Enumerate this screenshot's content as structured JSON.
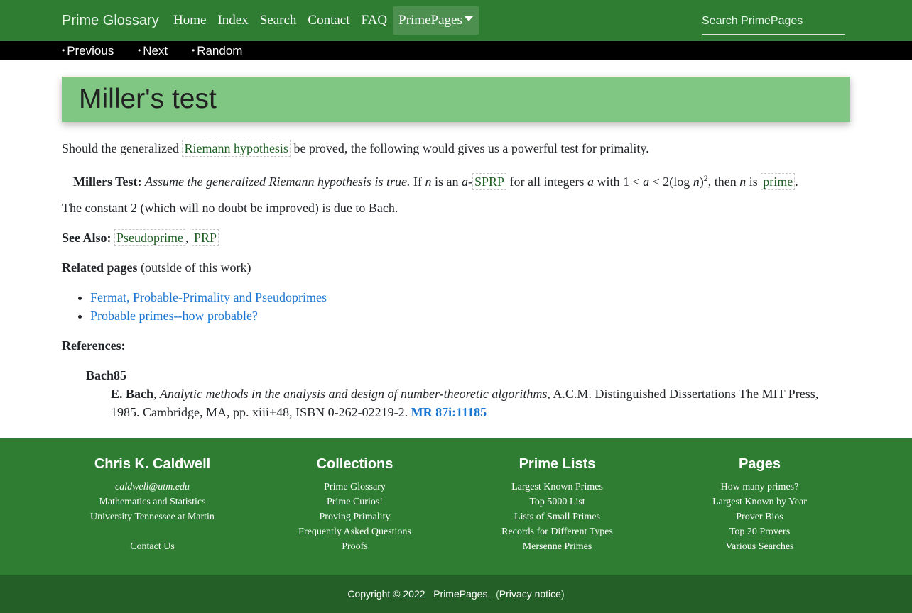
{
  "navbar": {
    "brand": "Prime Glossary",
    "links": [
      "Home",
      "Index",
      "Search",
      "Contact",
      "FAQ"
    ],
    "dropdown_label": "PrimePages",
    "search_placeholder": "Search PrimePages"
  },
  "subnav": {
    "previous": "Previous",
    "next": "Next",
    "random": "Random"
  },
  "page_title": "Miller's test",
  "intro": {
    "before": "Should the generalized ",
    "link": "Riemann hypothesis",
    "after": " be proved, the following would gives us a powerful test for primality."
  },
  "test": {
    "label": "Millers Test:",
    "assume": "Assume the generalized Riemann hypothesis is true.",
    "t1": " If ",
    "n1": "n",
    "t2": " is an ",
    "a1": "a",
    "dash": "-",
    "sprp": "SPRP",
    "t3": " for all integers ",
    "a2": "a",
    "t4": " with 1 < ",
    "a3": "a",
    "t5": " < 2(log ",
    "n2": "n",
    "t6": ")",
    "exp": "2",
    "t7": ", then ",
    "n3": "n",
    "t8": " is ",
    "prime": "prime",
    "t9": "."
  },
  "constant_note": "The constant 2 (which will no doubt be improved) is due to Bach.",
  "see_also": {
    "label": "See Also:",
    "links": [
      "Pseudoprime",
      "PRP"
    ],
    "separator": ", "
  },
  "related": {
    "label": "Related pages",
    "suffix": " (outside of this work)",
    "links": [
      "Fermat, Probable-Primality and Pseudoprimes",
      "Probable primes--how probable?"
    ]
  },
  "references": {
    "label": "References:",
    "key": "Bach85",
    "author": "E. Bach",
    "comma": ", ",
    "title": "Analytic methods in the analysis and design of number-theoretic algorithms",
    "rest": ", A.C.M. Distinguished Dissertations The MIT Press, 1985.  Cambridge, MA, pp. xiii+48, ISBN 0-262-02219-2. ",
    "mr": "MR 87i:11185"
  },
  "footer": {
    "columns": [
      {
        "title": "Chris K. Caldwell",
        "items": [
          "caldwell@utm.edu",
          "Mathematics and Statistics",
          "University Tennessee at Martin",
          "",
          "Contact Us"
        ]
      },
      {
        "title": "Collections",
        "items": [
          "Prime Glossary",
          "Prime Curios!",
          "Proving Primality",
          "Frequently Asked Questions",
          "Proofs"
        ]
      },
      {
        "title": "Prime Lists",
        "items": [
          "Largest Known Primes",
          "Top 5000 List",
          "Lists of Small Primes",
          "Records for Different Types",
          "Mersenne Primes"
        ]
      },
      {
        "title": "Pages",
        "items": [
          "How many primes?",
          "Largest Known by Year",
          "Prover Bios",
          "Top 20 Provers",
          "Various Searches"
        ]
      }
    ],
    "copyright": "Copyright © 2022",
    "site": "PrimePages",
    "dot": ".",
    "paren_open": "(",
    "privacy": "Privacy notice",
    "paren_close": ")"
  },
  "colors": {
    "nav_green": "#2e7d32",
    "title_green": "#81c784",
    "footer_dark": "#245f27",
    "link_blue": "#1976d2",
    "glossary_link": "#1b5e20"
  }
}
